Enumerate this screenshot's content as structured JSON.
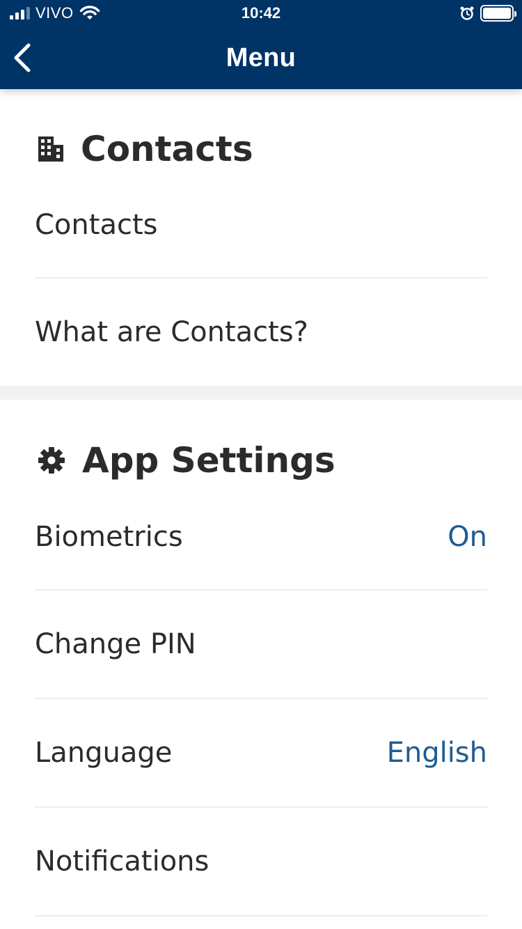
{
  "status_bar": {
    "carrier": "VIVO",
    "time": "10:42"
  },
  "nav": {
    "title": "Menu"
  },
  "sections": [
    {
      "title": "Contacts",
      "icon": "building-icon",
      "items": [
        {
          "label": "Contacts",
          "value": ""
        },
        {
          "label": "What are Contacts?",
          "value": ""
        }
      ]
    },
    {
      "title": "App Settings",
      "icon": "gear-icon",
      "items": [
        {
          "label": "Biometrics",
          "value": "On"
        },
        {
          "label": "Change PIN",
          "value": ""
        },
        {
          "label": "Language",
          "value": "English"
        },
        {
          "label": "Notifications",
          "value": ""
        }
      ]
    }
  ],
  "colors": {
    "header_bg": "#003366",
    "value_text": "#1f5b94",
    "divider": "#f1f1f1"
  }
}
